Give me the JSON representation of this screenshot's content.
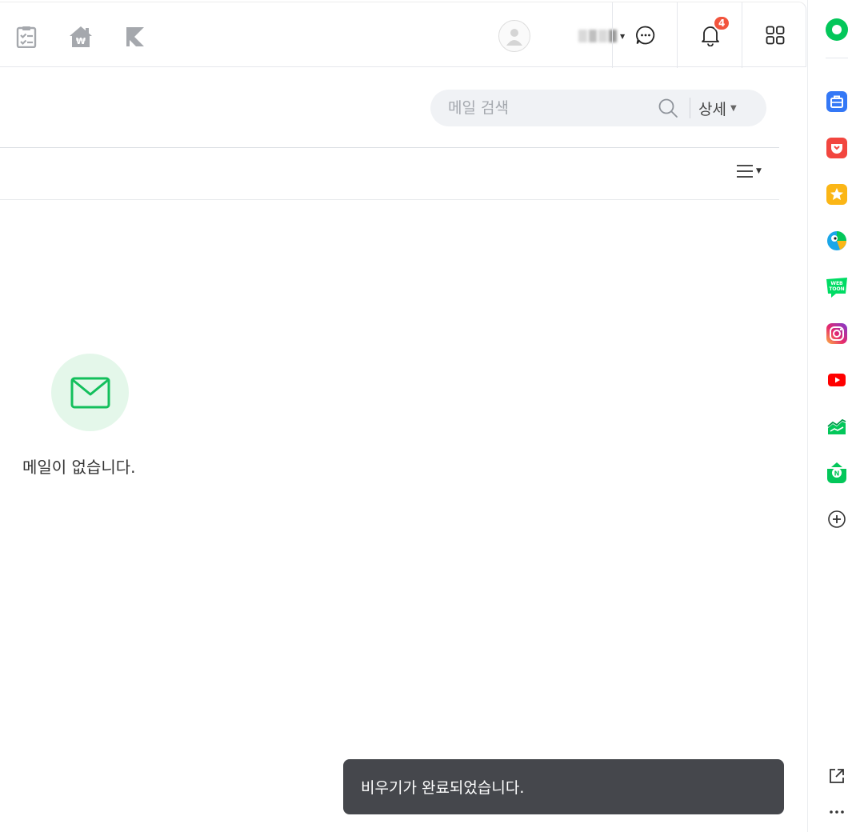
{
  "header": {
    "left_icons": [
      "checklist-icon",
      "house-won-icon",
      "k-logo-icon"
    ],
    "profile": {
      "avatar_icon": "user-icon",
      "name": ""
    },
    "actions": [
      {
        "name": "chat",
        "icon": "chat-bubble-icon"
      },
      {
        "name": "notifications",
        "icon": "bell-icon",
        "badge": "4"
      },
      {
        "name": "apps",
        "icon": "grid-icon"
      }
    ]
  },
  "search": {
    "placeholder": "메일 검색",
    "detail_label": "상세"
  },
  "list": {
    "view_menu_icon": "list-view-icon"
  },
  "empty_state": {
    "icon": "envelope-icon",
    "message": "메일이 없습니다."
  },
  "toast": {
    "message": "비우기가 완료되었습니다."
  },
  "right_rail": {
    "items": [
      {
        "name": "naver-green",
        "color": "#03c75a"
      },
      {
        "name": "briefcase",
        "color": "#3478f6"
      },
      {
        "name": "pocket-heart",
        "color": "#f2463f"
      },
      {
        "name": "star",
        "color": "#fbb616"
      },
      {
        "name": "pie-bird",
        "color": "#1aa6e8"
      },
      {
        "name": "webtoon",
        "color": "#00dc64"
      },
      {
        "name": "instagram",
        "color": "#d6249f"
      },
      {
        "name": "youtube",
        "color": "#ff0000"
      },
      {
        "name": "stocks",
        "color": "#03c75a"
      },
      {
        "name": "naver-pay",
        "color": "#03c75a"
      },
      {
        "name": "add",
        "color": "#333333"
      }
    ],
    "bottom": [
      "external-link-icon",
      "more-icon"
    ]
  }
}
